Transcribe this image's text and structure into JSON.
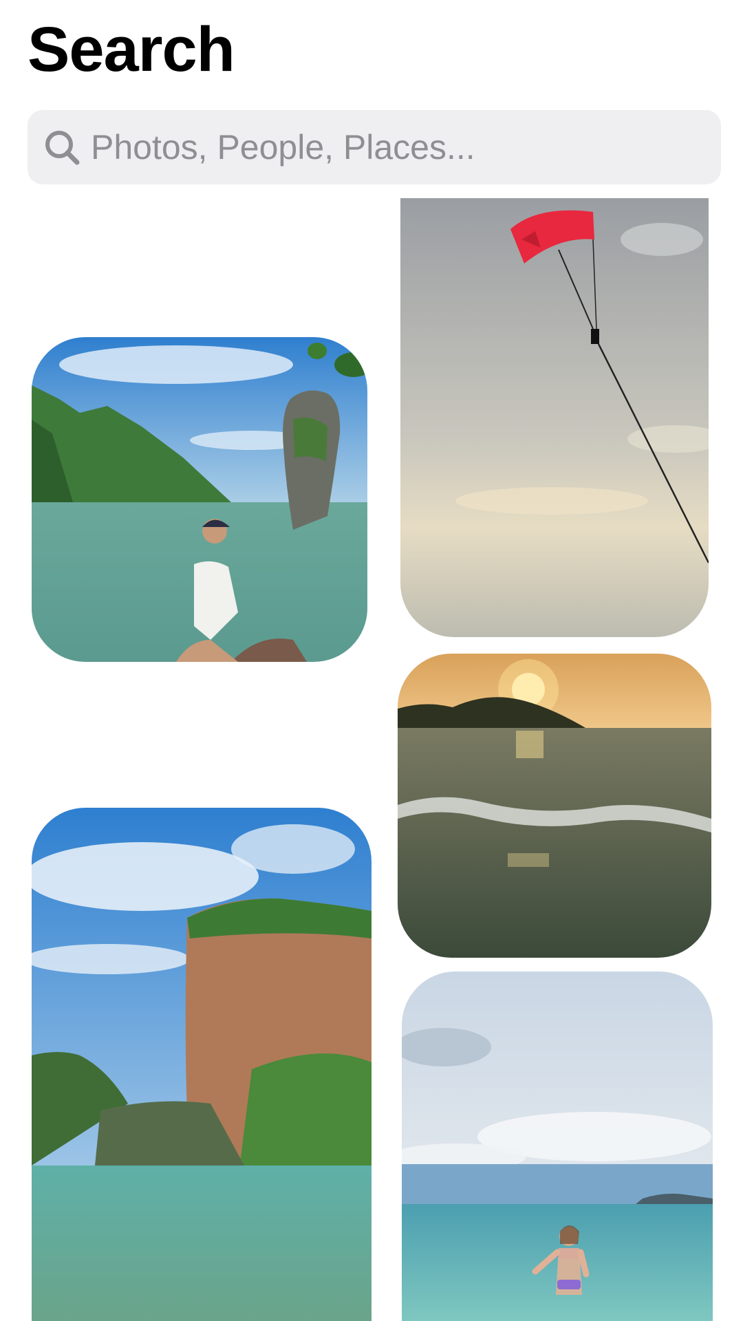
{
  "header": {
    "title": "Search"
  },
  "search": {
    "placeholder": "Photos, People, Places..."
  },
  "photos": [
    {
      "id": "rock-island-woman",
      "scene": "sea stack island with woman sitting on rock"
    },
    {
      "id": "parasail-sky",
      "scene": "red parasail over cloudy sky"
    },
    {
      "id": "sunset-waves",
      "scene": "sunset over ocean waves and island"
    },
    {
      "id": "limestone-cliff-bay",
      "scene": "tall limestone cliff in green bay"
    },
    {
      "id": "beach-woman-sea",
      "scene": "woman standing in turquoise sea under cloudy sky"
    }
  ],
  "colors": {
    "search_bg": "#efeff1",
    "placeholder": "#8e8e93",
    "sea_green": "#6fa79c",
    "sky_blue": "#3b86d6"
  }
}
